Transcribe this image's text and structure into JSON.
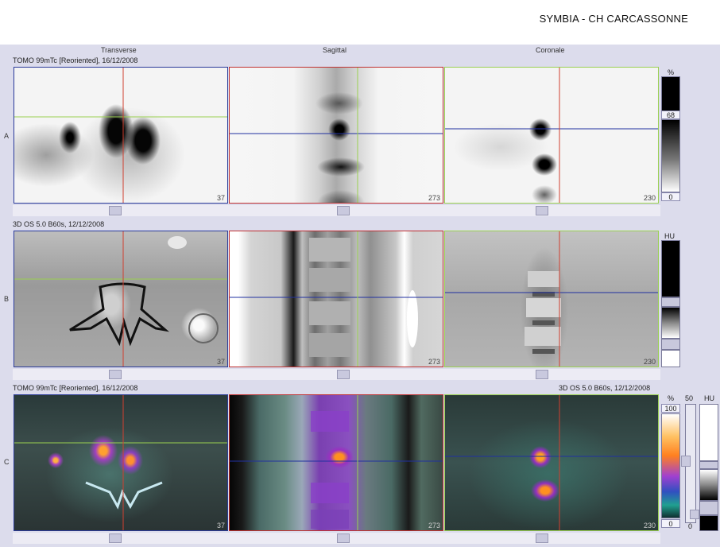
{
  "header": {
    "title": "SYMBIA - CH CARCASSONNE"
  },
  "columns": [
    "Transverse",
    "Sagittal",
    "Coronale"
  ],
  "rows": [
    {
      "letter": "A",
      "info": "TOMO 99mTc [Reoriented], 16/12/2008",
      "numbers": [
        "37",
        "273",
        "230"
      ]
    },
    {
      "letter": "B",
      "info": "3D  OS  5.0  B60s, 12/12/2008",
      "numbers": [
        "37",
        "273",
        "230"
      ]
    },
    {
      "letter": "C",
      "info": "TOMO 99mTc [Reoriented], 16/12/2008",
      "info_right": "3D  OS  5.0  B60s, 12/12/2008",
      "numbers": [
        "37",
        "273",
        "230"
      ]
    }
  ],
  "colorbars": {
    "a": {
      "unit": "%",
      "top_value": "68",
      "bottom_value": "0"
    },
    "b": {
      "unit": "HU"
    },
    "c": {
      "unit_left": "%",
      "value_mid": "50",
      "unit_right": "HU",
      "top_value": "100",
      "bottom_value": "0",
      "small_zero": "0"
    }
  }
}
